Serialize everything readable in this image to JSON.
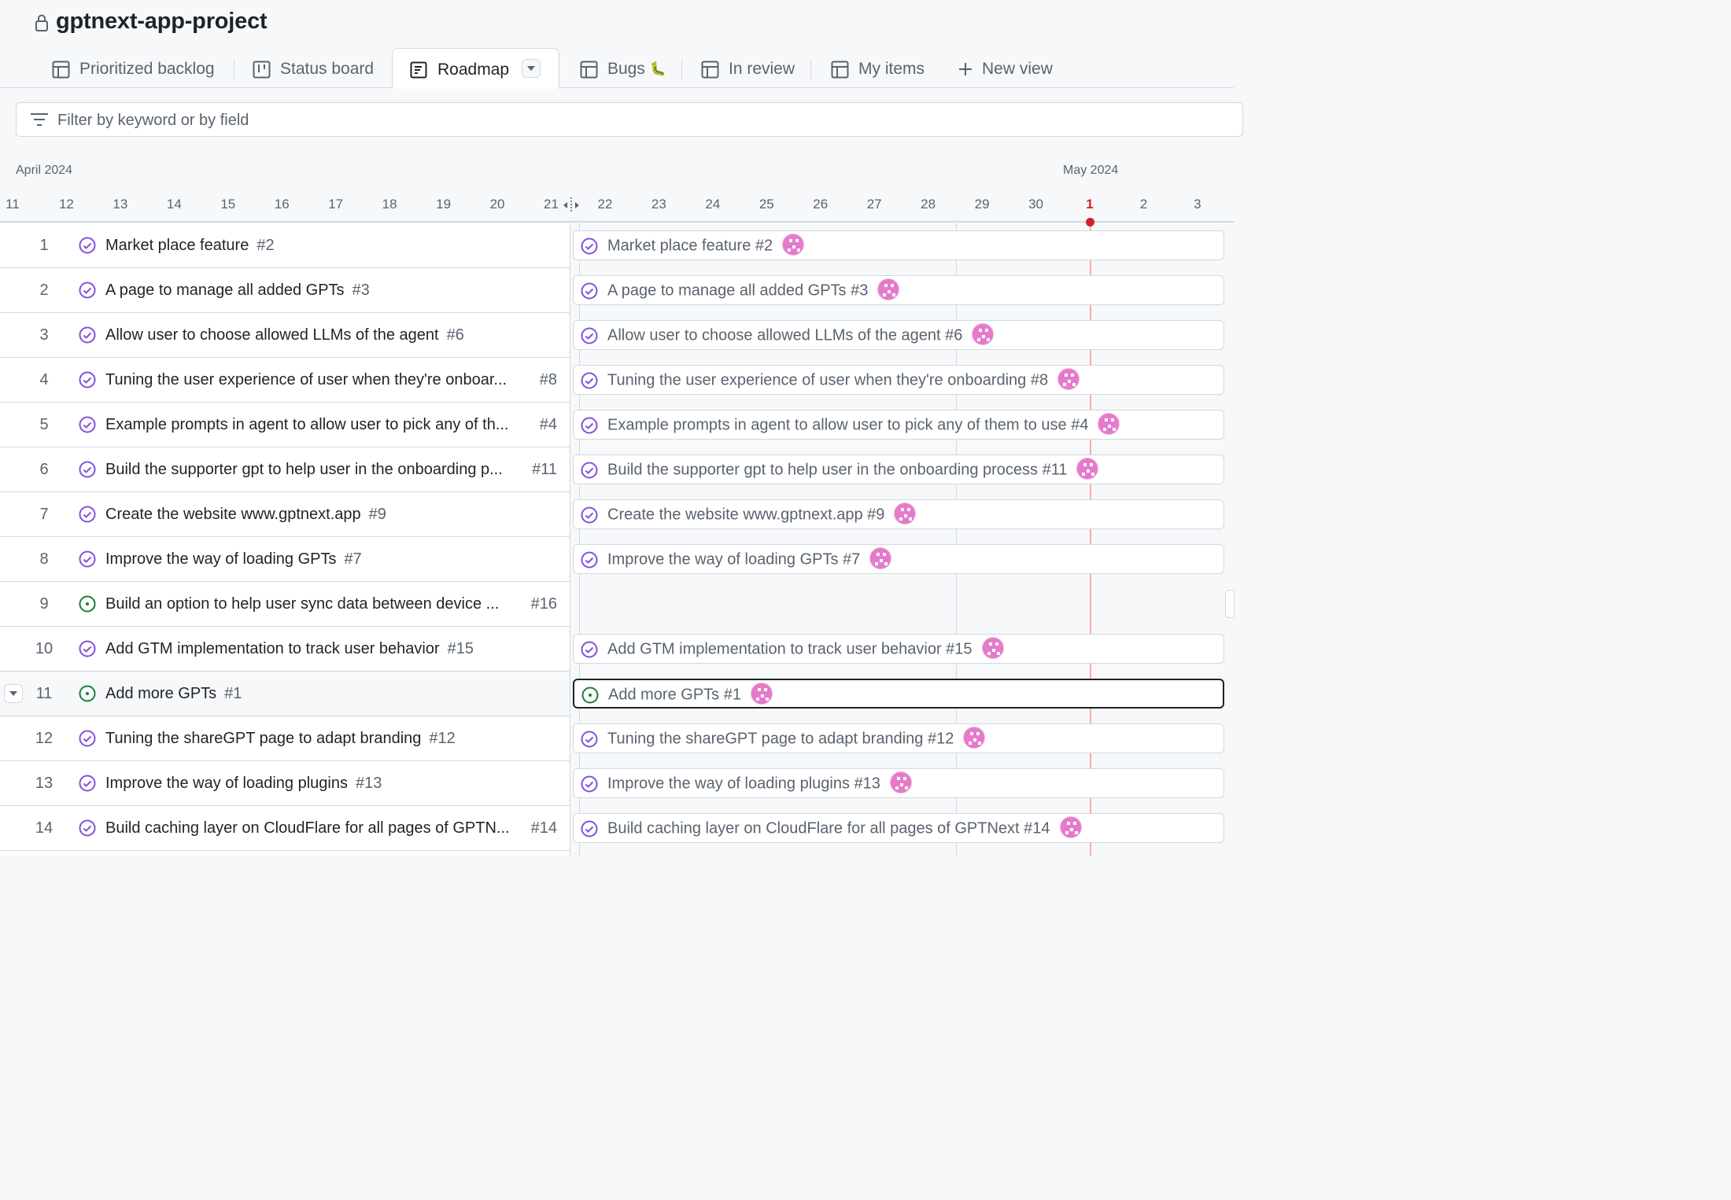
{
  "project": {
    "title": "gptnext-app-project",
    "icon": "lock-icon"
  },
  "tabs": [
    {
      "label": "Prioritized backlog",
      "icon": "table-icon",
      "active": false
    },
    {
      "label": "Status board",
      "icon": "board-icon",
      "active": false
    },
    {
      "label": "Roadmap",
      "icon": "roadmap-icon",
      "active": true
    },
    {
      "label": "Bugs",
      "icon": "table-icon",
      "emoji": "🐛",
      "active": false
    },
    {
      "label": "In review",
      "icon": "table-icon",
      "active": false
    },
    {
      "label": "My items",
      "icon": "table-icon",
      "active": false
    },
    {
      "label": "New view",
      "icon": "plus-icon",
      "active": false
    }
  ],
  "filter": {
    "placeholder": "Filter by keyword or by field",
    "icon": "filter-icon"
  },
  "timeline": {
    "months": [
      "April 2024",
      "May 2024"
    ],
    "days": [
      "11",
      "12",
      "13",
      "14",
      "15",
      "16",
      "17",
      "18",
      "19",
      "20",
      "21",
      "22",
      "23",
      "24",
      "25",
      "26",
      "27",
      "28",
      "29",
      "30",
      "1",
      "2",
      "3"
    ],
    "today": "1"
  },
  "colors": {
    "closed": "#8250df",
    "open": "#1a7f37",
    "today": "#cf222e",
    "avatar": "#e57acb"
  },
  "items": [
    {
      "num": "1",
      "title": "Market place feature",
      "title_trunc": "",
      "issue": "#2",
      "state": "closed",
      "bar": "Market place feature #2"
    },
    {
      "num": "2",
      "title": "A page to manage all added GPTs",
      "title_trunc": "",
      "issue": "#3",
      "state": "closed",
      "bar": "A page to manage all added GPTs #3"
    },
    {
      "num": "3",
      "title": "Allow user to choose allowed LLMs of the agent",
      "title_trunc": "",
      "issue": "#6",
      "state": "closed",
      "bar": "Allow user to choose allowed LLMs of the agent #6"
    },
    {
      "num": "4",
      "title": "",
      "title_trunc": "Tuning the user experience of user when they're onboar...",
      "issue": "#8",
      "state": "closed",
      "bar": "Tuning the user experience of user when they're onboarding #8"
    },
    {
      "num": "5",
      "title": "",
      "title_trunc": "Example prompts in agent to allow user to pick any of th...",
      "issue": "#4",
      "state": "closed",
      "bar": "Example prompts in agent to allow user to pick any of them to use #4"
    },
    {
      "num": "6",
      "title": "",
      "title_trunc": "Build the supporter gpt to help user in the onboarding p...",
      "issue": "#11",
      "state": "closed",
      "bar": "Build the supporter gpt to help user in the onboarding process #11"
    },
    {
      "num": "7",
      "title": "Create the website www.gptnext.app",
      "title_trunc": "",
      "issue": "#9",
      "state": "closed",
      "bar": "Create the website www.gptnext.app #9"
    },
    {
      "num": "8",
      "title": "Improve the way of loading GPTs",
      "title_trunc": "",
      "issue": "#7",
      "state": "closed",
      "bar": "Improve the way of loading GPTs #7"
    },
    {
      "num": "9",
      "title": "",
      "title_trunc": "Build an option to help user sync data between device ...",
      "issue": "#16",
      "state": "open",
      "bar": ""
    },
    {
      "num": "10",
      "title": "Add GTM implementation to track user behavior",
      "title_trunc": "",
      "issue": "#15",
      "state": "closed",
      "bar": "Add GTM implementation to track user behavior #15"
    },
    {
      "num": "11",
      "title": "Add more GPTs",
      "title_trunc": "",
      "issue": "#1",
      "state": "open",
      "bar": "Add more GPTs #1",
      "selected": true
    },
    {
      "num": "12",
      "title": "Tuning the shareGPT page to adapt branding",
      "title_trunc": "",
      "issue": "#12",
      "state": "closed",
      "bar": "Tuning the shareGPT page to adapt branding #12"
    },
    {
      "num": "13",
      "title": "Improve the way of loading plugins",
      "title_trunc": "",
      "issue": "#13",
      "state": "closed",
      "bar": "Improve the way of loading plugins #13"
    },
    {
      "num": "14",
      "title": "",
      "title_trunc": "Build caching layer on CloudFlare for all pages of GPTN...",
      "issue": "#14",
      "state": "closed",
      "bar": "Build caching layer on CloudFlare for all pages of GPTNext #14"
    }
  ]
}
